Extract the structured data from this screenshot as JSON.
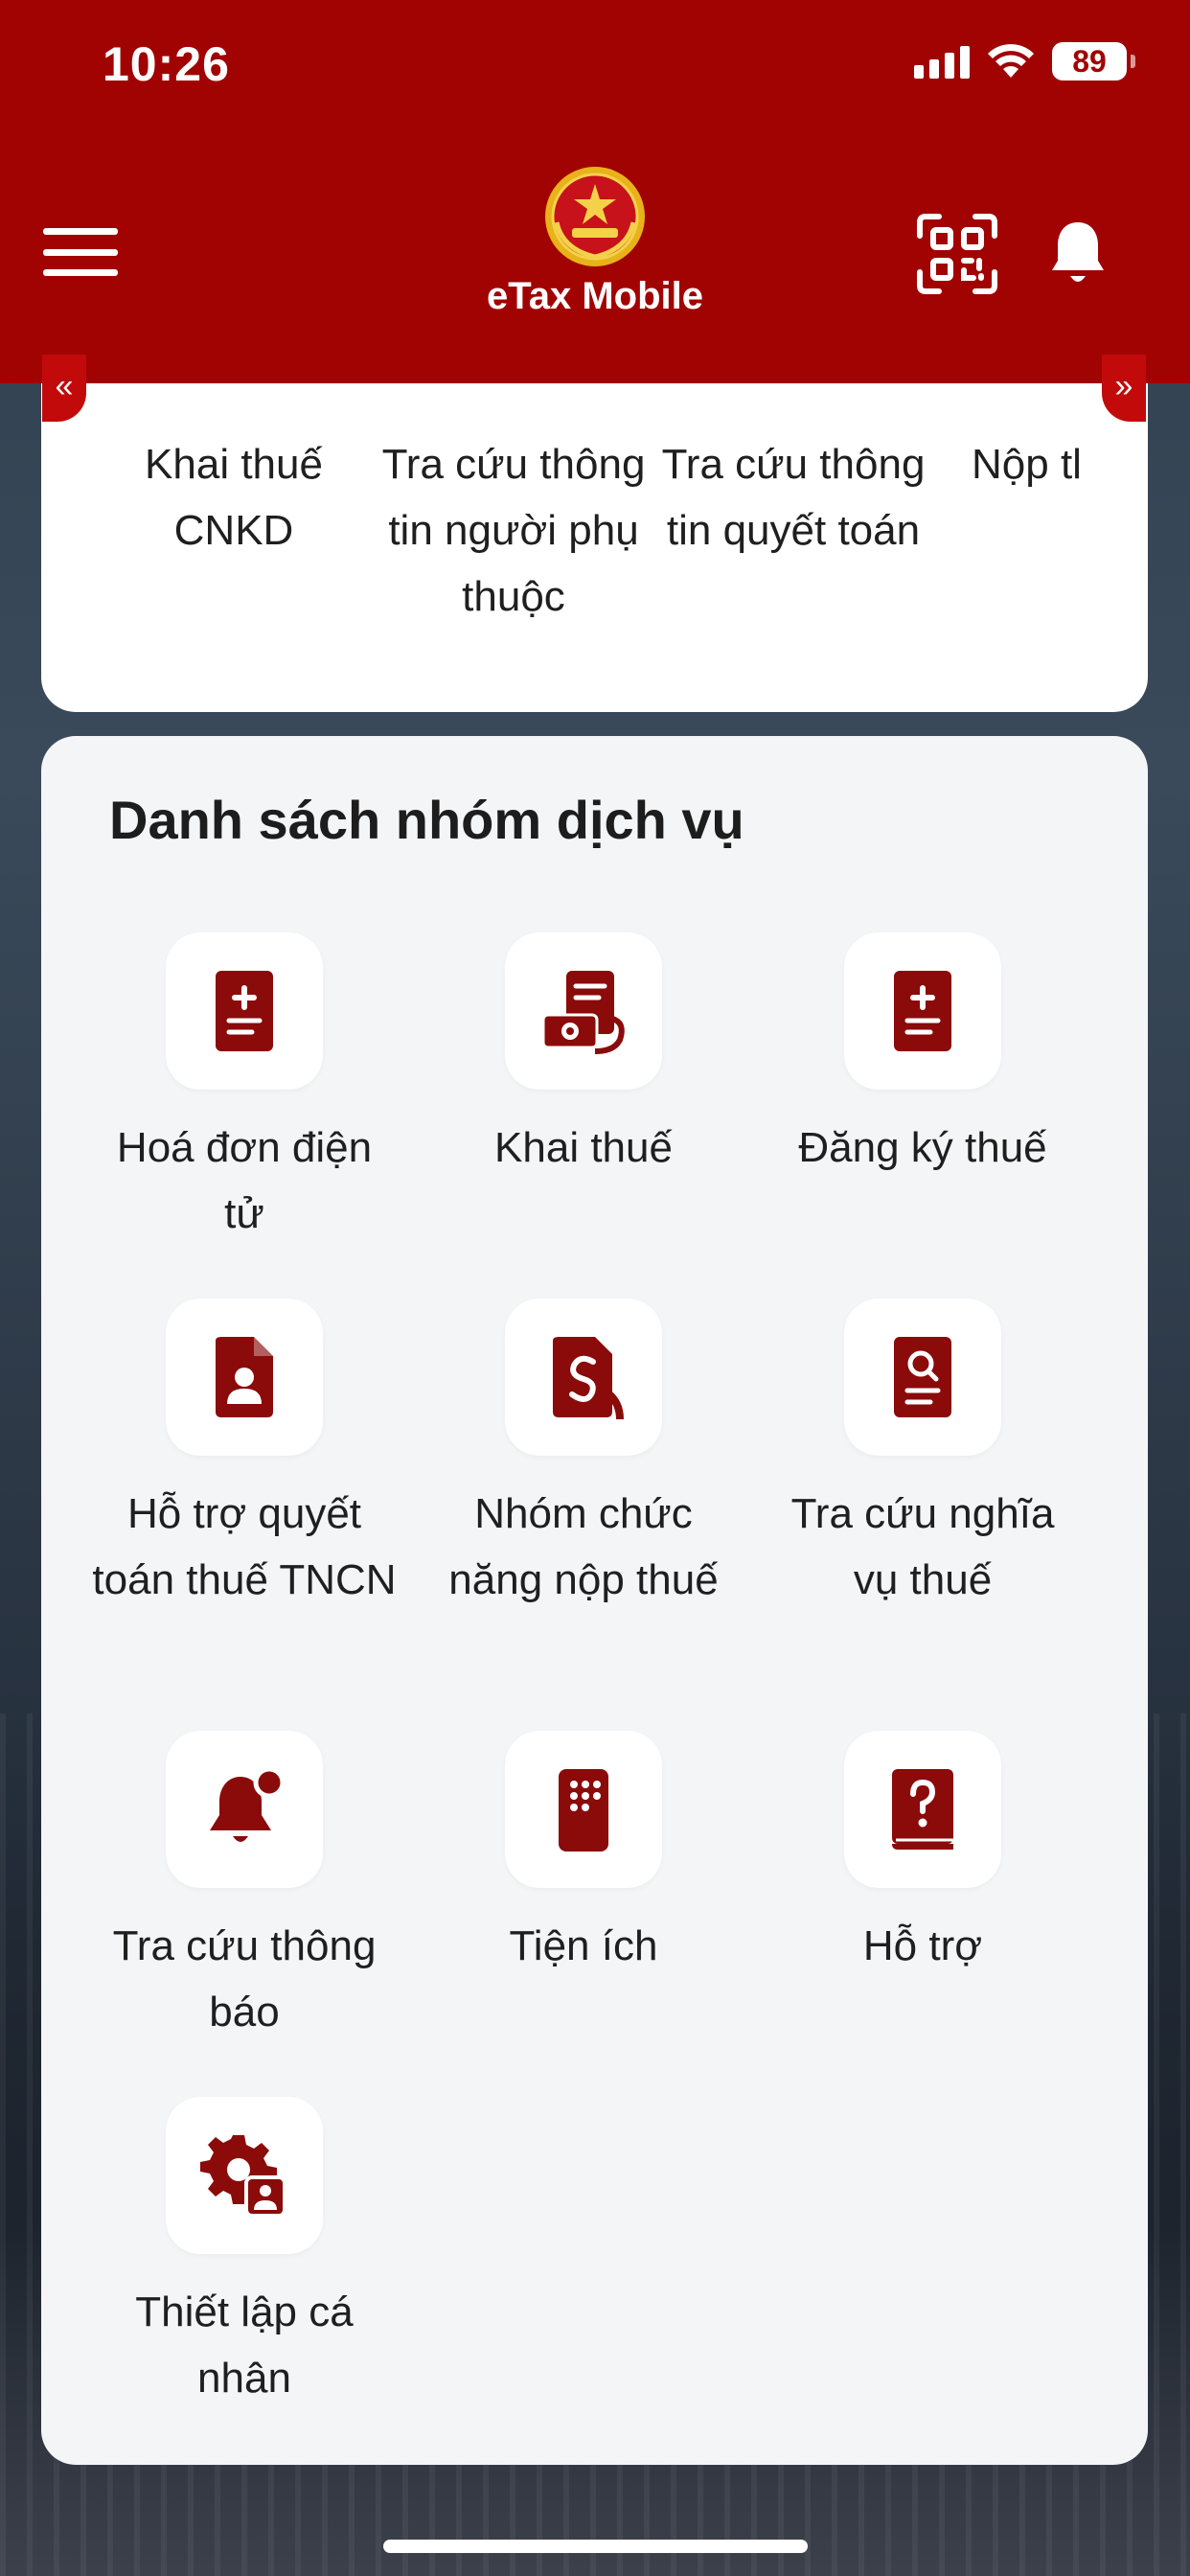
{
  "status_bar": {
    "time": "10:26",
    "battery": "89"
  },
  "header": {
    "title": "eTax Mobile",
    "menu_icon": "hamburger-icon",
    "qr_icon": "qr-scan-icon",
    "bell_icon": "bell-icon"
  },
  "quick_access": {
    "items": [
      {
        "label": "Khai thuế CNKD"
      },
      {
        "label": "Tra cứu thông tin người phụ thuộc"
      },
      {
        "label": "Tra cứu thông tin quyết toán"
      },
      {
        "label": "Nộp tl"
      }
    ],
    "arrow_left": "«",
    "arrow_right": "»"
  },
  "services": {
    "title": "Danh sách nhóm dịch vụ",
    "items": [
      {
        "label": "Hoá đơn điện tử",
        "icon": "invoice-plus-icon"
      },
      {
        "label": "Khai thuế",
        "icon": "tax-declaration-icon"
      },
      {
        "label": "Đăng ký thuế",
        "icon": "register-plus-icon"
      },
      {
        "label": "Hỗ trợ quyết toán thuế TNCN",
        "icon": "person-document-icon"
      },
      {
        "label": "Nhóm chức năng nộp thuế",
        "icon": "payment-document-icon"
      },
      {
        "label": "Tra cứu nghĩa vụ thuế",
        "icon": "search-document-icon"
      },
      {
        "label": "Tra cứu thông báo",
        "icon": "notification-bell-icon"
      },
      {
        "label": "Tiện ích",
        "icon": "utility-keypad-icon"
      },
      {
        "label": "Hỗ trợ",
        "icon": "help-book-icon"
      },
      {
        "label": "Thiết lập cá nhân",
        "icon": "user-settings-icon"
      }
    ]
  },
  "colors": {
    "brand": "#a10303",
    "icon": "#8b0a0a",
    "card": "#f4f5f7"
  }
}
